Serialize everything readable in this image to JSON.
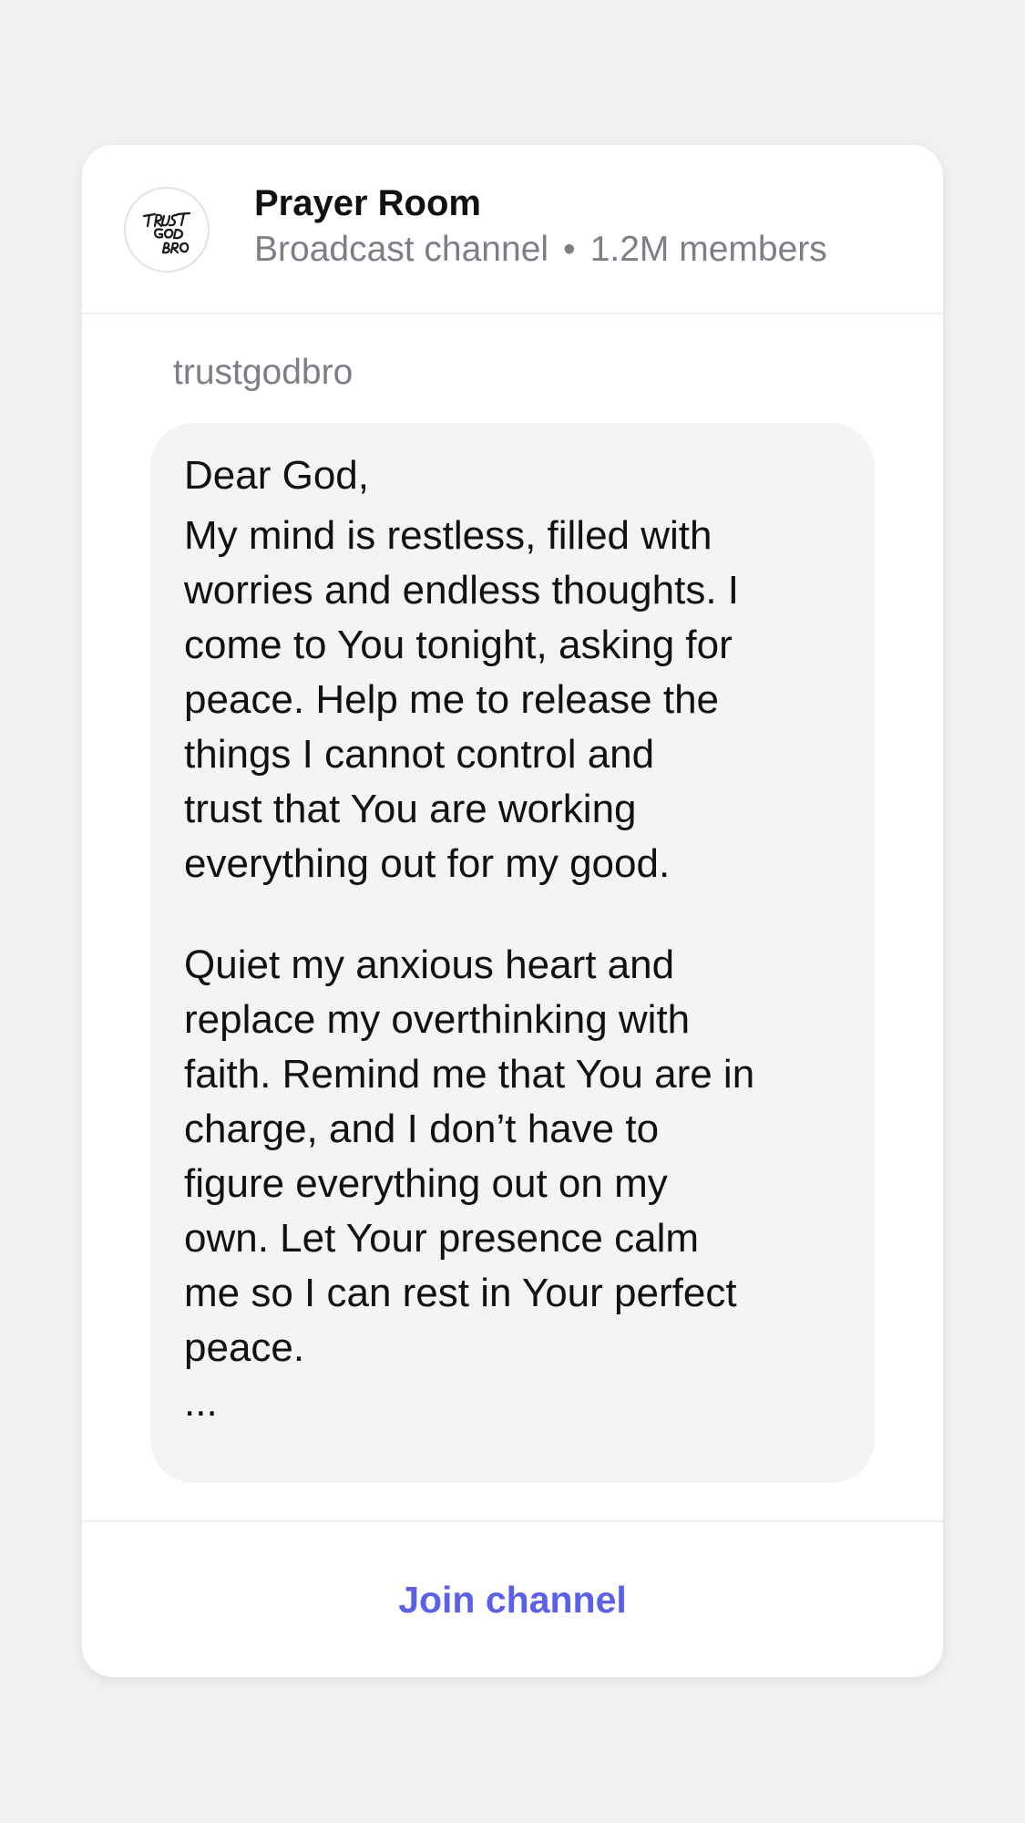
{
  "channel": {
    "name": "Prayer Room",
    "type": "Broadcast channel",
    "separator": "•",
    "members": "1.2M members",
    "avatar_icon": "trust-god-bro-logo",
    "avatar_text": "TRUST GOD BRO"
  },
  "message": {
    "sender": "trustgodbro",
    "greeting": "Dear God,",
    "paragraphs": [
      [
        "My mind is restless, filled with",
        "worries and endless thoughts. I",
        "come to You tonight, asking for",
        "peace. Help me to release the",
        "things I cannot control and",
        "trust that You are working",
        "everything out for my good."
      ],
      [
        "Quiet my anxious heart and",
        "replace my overthinking with",
        "faith. Remind me that You are in",
        "charge, and I don’t have to",
        "figure everything out on my",
        "own. Let Your presence calm",
        "me so I can rest in Your perfect",
        "peace."
      ]
    ],
    "ellipsis": "..."
  },
  "footer": {
    "join_label": "Join channel"
  },
  "colors": {
    "background": "#f1f1f2",
    "card": "#ffffff",
    "bubble": "#f3f4f6",
    "accent": "#5b61e6",
    "muted_text": "#7d7f86"
  }
}
